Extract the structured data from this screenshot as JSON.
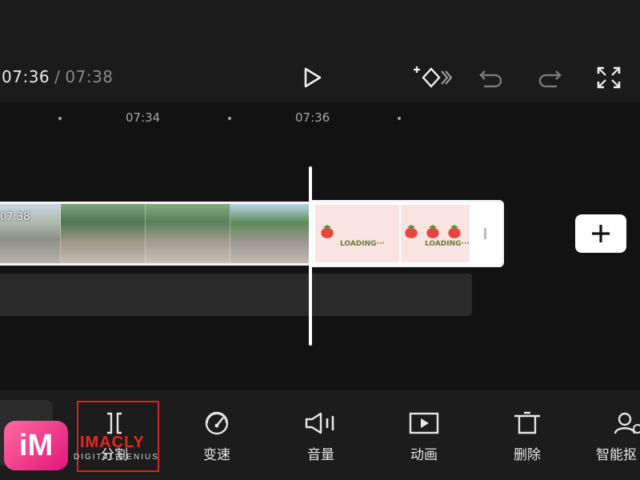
{
  "header": {
    "current_time": "07:36",
    "separator": "/",
    "total_time": "07:38",
    "icons": [
      "play-icon",
      "keyframe-add-icon",
      "undo-icon",
      "redo-icon",
      "fullscreen-icon"
    ]
  },
  "ruler": {
    "labels": [
      "07:34",
      "07:36"
    ]
  },
  "timeline": {
    "clip_time": "07:38",
    "loading_text": "LOADING···"
  },
  "toolbar": {
    "items": [
      {
        "label": "分割",
        "icon": "split-icon"
      },
      {
        "label": "变速",
        "icon": "speed-icon"
      },
      {
        "label": "音量",
        "icon": "volume-icon"
      },
      {
        "label": "动画",
        "icon": "animation-icon"
      },
      {
        "label": "删除",
        "icon": "delete-icon"
      },
      {
        "label": "智能抠",
        "icon": "smart-cutout-icon"
      }
    ]
  },
  "watermark": {
    "logo": "iM",
    "brand": "IMACLY",
    "tagline": "DIGITAL GENIUS"
  },
  "colors": {
    "background": "#121212",
    "topbar": "#1b1b1b",
    "selection_border": "#e02020",
    "loading_pink": "#f9e4e1",
    "watermark_logo": "#e3157a"
  }
}
